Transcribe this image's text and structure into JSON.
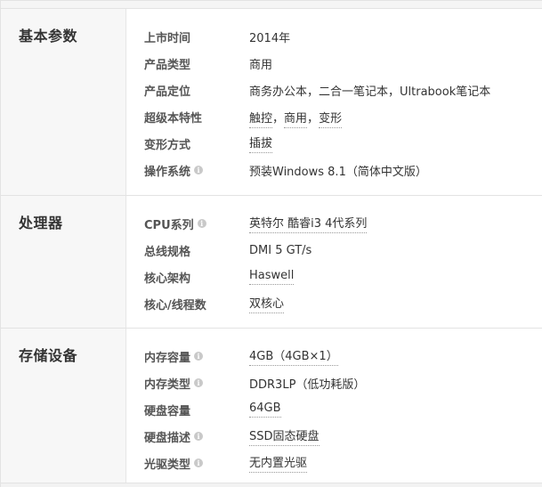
{
  "sections": [
    {
      "title": "基本参数",
      "rows": [
        {
          "label": "上市时间",
          "value": "2014年"
        },
        {
          "label": "产品类型",
          "value": "商用"
        },
        {
          "label": "产品定位",
          "value": "商务办公本，二合一笔记本，Ultrabook笔记本"
        },
        {
          "label": "超级本特性",
          "value_parts": [
            "触控",
            "，",
            "商用",
            "，",
            "变形"
          ]
        },
        {
          "label": "变形方式",
          "value": "插拔"
        },
        {
          "label": "操作系统",
          "value": "预装Windows 8.1（简体中文版）"
        }
      ]
    },
    {
      "title": "处理器",
      "rows": [
        {
          "label": "CPU系列",
          "value": "英特尔 酷睿i3 4代系列"
        },
        {
          "label": "总线规格",
          "value": "DMI 5 GT/s"
        },
        {
          "label": "核心架构",
          "value": "Haswell"
        },
        {
          "label": "核心/线程数",
          "value": "双核心"
        }
      ]
    },
    {
      "title": "存储设备",
      "rows": [
        {
          "label": "内存容量",
          "value": "4GB（4GB×1）"
        },
        {
          "label": "内存类型",
          "value": "DDR3LP（低功耗版）"
        },
        {
          "label": "硬盘容量",
          "value": "64GB"
        },
        {
          "label": "硬盘描述",
          "value": "SSD固态硬盘"
        },
        {
          "label": "光驱类型",
          "value": "无内置光驱"
        }
      ]
    }
  ],
  "icons": {
    "info": "info-icon"
  },
  "info_glyph": "i"
}
